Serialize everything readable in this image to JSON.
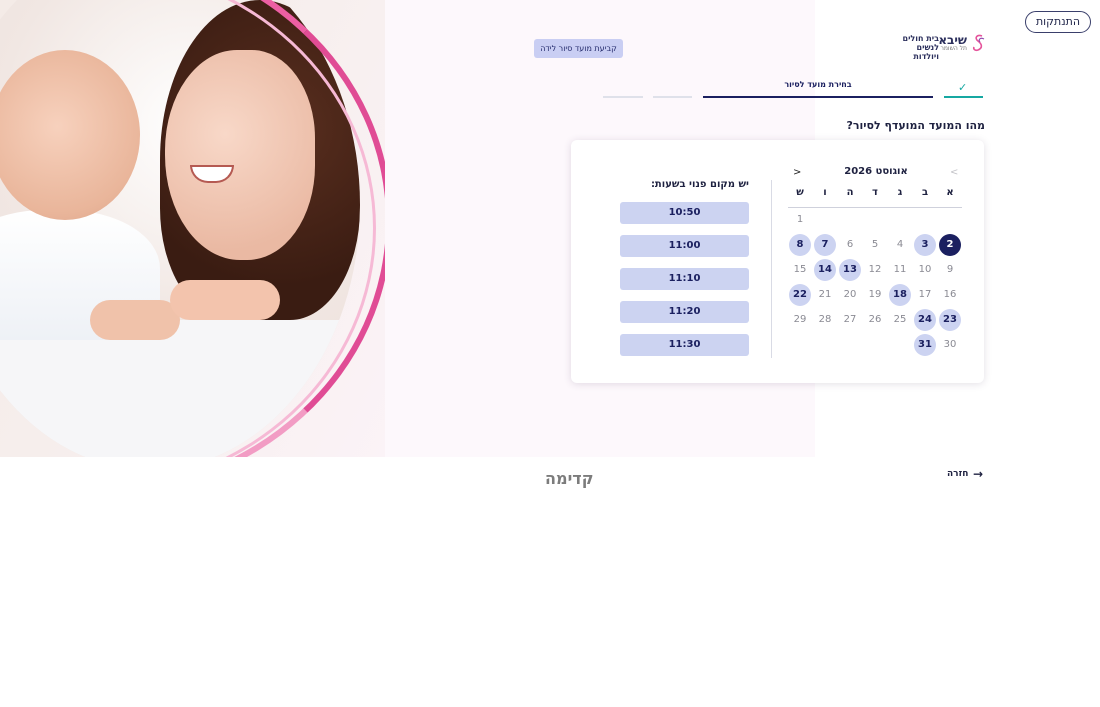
{
  "header": {
    "logout_label": "התנתקות",
    "book_tour_label": "קביעת מועד סיור לידה",
    "logo": {
      "main": "שיבא",
      "sub": "תל השומר",
      "hospital": "בית חולים לנשים ויולדות"
    }
  },
  "steps": {
    "done_mark": "✓",
    "current_label": "בחירת מועד לסיור"
  },
  "question": "מהו המועד המועדף לסיור?",
  "calendar": {
    "month_title": "אוגוסט 2026",
    "prev": "<",
    "next": ">",
    "weekdays": [
      "א",
      "ב",
      "ג",
      "ד",
      "ה",
      "ו",
      "ש"
    ],
    "days": {
      "d1": "1",
      "d2": "2",
      "d3": "3",
      "d4": "4",
      "d5": "5",
      "d6": "6",
      "d7": "7",
      "d8": "8",
      "d9": "9",
      "d10": "10",
      "d11": "11",
      "d12": "12",
      "d13": "13",
      "d14": "14",
      "d15": "15",
      "d16": "16",
      "d17": "17",
      "d18": "18",
      "d19": "19",
      "d20": "20",
      "d21": "21",
      "d22": "22",
      "d23": "23",
      "d24": "24",
      "d25": "25",
      "d26": "26",
      "d27": "27",
      "d28": "28",
      "d29": "29",
      "d30": "30",
      "d31": "31"
    },
    "selected_day": "2",
    "available_days": [
      "3",
      "7",
      "8",
      "13",
      "14",
      "18",
      "22",
      "23",
      "24",
      "31"
    ]
  },
  "times": {
    "title": "יש מקום פנוי בשעות:",
    "slots": [
      "10:50",
      "11:00",
      "11:10",
      "11:20",
      "11:30"
    ]
  },
  "footer": {
    "back_label": "חזרה",
    "back_arrow": "→",
    "brand": "קדימה"
  },
  "colors": {
    "primary": "#1b2060",
    "slot_bg": "#ccd3f1",
    "accent_teal": "#16a8a2",
    "pink": "#e5549b"
  }
}
